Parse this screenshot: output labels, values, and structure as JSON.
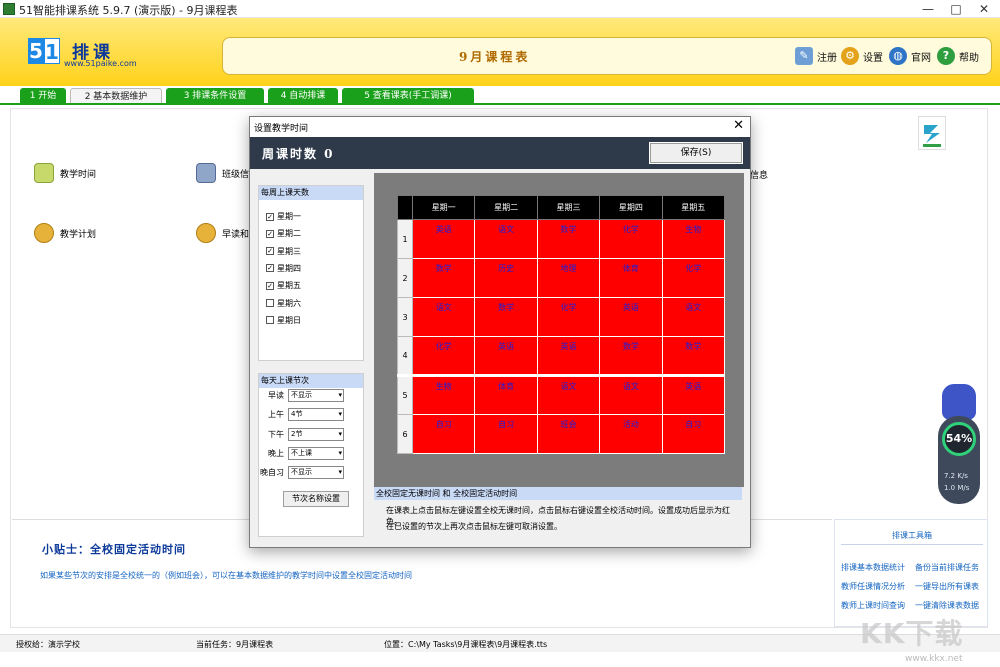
{
  "window": {
    "title": "51智能排课系统 5.9.7 (演示版) - 9月课程表",
    "controls": {
      "minimize": "—",
      "maximize": "□",
      "close": "✕"
    }
  },
  "header": {
    "logo_digits": [
      "5",
      "1"
    ],
    "logo_name": "排课",
    "logo_url": "www.51paike.com",
    "banner_title": "9月课程表",
    "buttons": [
      {
        "label": "注册",
        "icon": "register-icon"
      },
      {
        "label": "设置",
        "icon": "settings-gear-icon"
      },
      {
        "label": "官网",
        "icon": "globe-icon"
      },
      {
        "label": "帮助",
        "icon": "help-icon"
      }
    ]
  },
  "tabs": [
    {
      "label": "1 开始",
      "active": false
    },
    {
      "label": "2 基本数据维护",
      "active": true
    },
    {
      "label": "3 排课条件设置",
      "active": false
    },
    {
      "label": "4 自动排课",
      "active": false
    },
    {
      "label": "5 查看课表(手工调课)",
      "active": false
    }
  ],
  "main": {
    "features": [
      "教学时间",
      "班级信息",
      "教学计划",
      "早读和晚自习",
      "信息"
    ]
  },
  "tips": {
    "title": "小贴士：全校固定活动时间",
    "text": "如果某些节次的安排是全校统一的（例如班会），可以在基本数据维护的教学时间中设置全校固定活动时间"
  },
  "tools": {
    "title": "排课工具箱",
    "links": [
      "排课基本数据统计",
      "备份当前排课任务",
      "教师任课情况分析",
      "一键导出所有课表",
      "教师上课时间查询",
      "一键清除课表数据"
    ]
  },
  "statusbar": {
    "license": "授权给：演示学校",
    "task": "当前任务：9月课程表",
    "path": "位置：C:\\My Tasks\\9月课程表\\9月课程表.tts"
  },
  "speed_widget": {
    "percent": "54%",
    "upload": "7.2 K/s",
    "download": "1.0 M/s"
  },
  "watermark": {
    "brand": "KK下载",
    "url": "www.kkx.net"
  },
  "dialog": {
    "title": "设置教学时间",
    "close": "✕",
    "header": "周课时数 0",
    "save_label": "保存(S)",
    "days_panel": {
      "title": "每周上课天数",
      "days": [
        {
          "label": "星期一",
          "checked": true
        },
        {
          "label": "星期二",
          "checked": true
        },
        {
          "label": "星期三",
          "checked": true
        },
        {
          "label": "星期四",
          "checked": true
        },
        {
          "label": "星期五",
          "checked": true
        },
        {
          "label": "星期六",
          "checked": false
        },
        {
          "label": "星期日",
          "checked": false
        }
      ]
    },
    "sections_panel": {
      "title": "每天上课节次",
      "rows": [
        {
          "label": "早读",
          "value": "不显示"
        },
        {
          "label": "上午",
          "value": "4节"
        },
        {
          "label": "下午",
          "value": "2节"
        },
        {
          "label": "晚上",
          "value": "不上课"
        },
        {
          "label": "晚自习",
          "value": "不显示"
        }
      ],
      "name_button": "节次名称设置"
    },
    "grid": {
      "columns": [
        "星期一",
        "星期二",
        "星期三",
        "星期四",
        "星期五"
      ],
      "rows": [
        {
          "num": "1",
          "cells": [
            "英语",
            "语文",
            "数学",
            "化学",
            "生物"
          ]
        },
        {
          "num": "2",
          "cells": [
            "数学",
            "历史",
            "地理",
            "体育",
            "化学"
          ]
        },
        {
          "num": "3",
          "cells": [
            "语文",
            "数学",
            "化学",
            "英语",
            "语文"
          ]
        },
        {
          "num": "4",
          "cells": [
            "化学",
            "英语",
            "英语",
            "数学",
            "数学"
          ]
        },
        {
          "num": "5",
          "cells": [
            "生物",
            "体育",
            "语文",
            "语文",
            "英语"
          ]
        },
        {
          "num": "6",
          "cells": [
            "自习",
            "自习",
            "班会",
            "活动",
            "自习"
          ]
        }
      ]
    },
    "note": {
      "heading": "全校固定无课时间 和 全校固定活动时间",
      "line1": "在课表上点击鼠标左键设置全校无课时间，点击鼠标右键设置全校活动时间。设置成功后显示为红色。",
      "line2": "在已设置的节次上再次点击鼠标左键可取消设置。"
    }
  }
}
